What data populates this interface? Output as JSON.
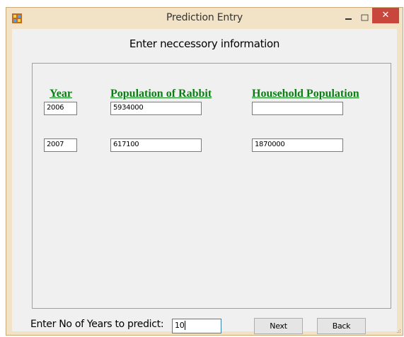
{
  "window": {
    "title": "Prediction Entry",
    "minimize_icon": "minimize-icon",
    "maximize_icon": "maximize-icon",
    "close_icon": "close-icon",
    "close_glyph": "✕"
  },
  "form": {
    "heading": "Enter neccessory information",
    "columns": {
      "year": "Year",
      "rabbit": "Population of Rabbit",
      "household": "Household Population"
    },
    "rows": [
      {
        "year": "2006",
        "rabbit": "5934000",
        "household": ""
      },
      {
        "year": "2007",
        "rabbit": "617100",
        "household": "1870000"
      }
    ]
  },
  "footer": {
    "years_label": "Enter No of Years to predict:",
    "years_value": "10",
    "next_label": "Next",
    "back_label": "Back"
  },
  "colors": {
    "header_green": "#0a7d14",
    "close_red": "#c9463d",
    "frame": "#f3e3c6"
  }
}
